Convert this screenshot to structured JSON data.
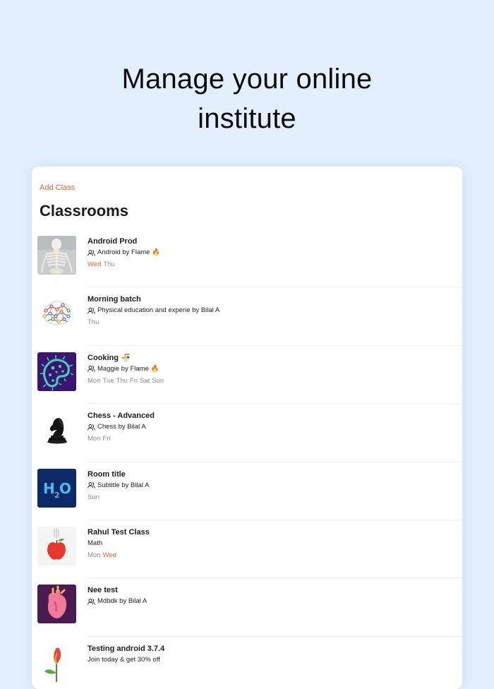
{
  "headline": {
    "line1": "Manage your online",
    "line2": "institute"
  },
  "card": {
    "add_class_label": "Add Class",
    "title": "Classrooms"
  },
  "accent_color": "#e0632b",
  "classes": [
    {
      "title": "Android Prod",
      "subtitle": "Android by Flame 🔥",
      "show_people_icon": true,
      "thumbnail": "skeleton",
      "days": [
        {
          "label": "Wed",
          "active": true
        },
        {
          "label": "Thu",
          "active": false
        }
      ]
    },
    {
      "title": "Morning batch",
      "subtitle": "Physical education and experie by Bilal A",
      "show_people_icon": true,
      "thumbnail": "brain-network",
      "days": [
        {
          "label": "Thu",
          "active": false
        }
      ]
    },
    {
      "title": "Cooking 🍜",
      "subtitle": "Maggie by Flame 🔥",
      "show_people_icon": true,
      "thumbnail": "microbe",
      "days": [
        {
          "label": "Mon",
          "active": false
        },
        {
          "label": "Tue",
          "active": false
        },
        {
          "label": "Thu",
          "active": false
        },
        {
          "label": "Fri",
          "active": false
        },
        {
          "label": "Sat",
          "active": false
        },
        {
          "label": "Sun",
          "active": false
        }
      ]
    },
    {
      "title": "Chess - Advanced",
      "subtitle": "Chess by Bilal A",
      "show_people_icon": true,
      "thumbnail": "chess-knight",
      "days": [
        {
          "label": "Mon",
          "active": false
        },
        {
          "label": "Fri",
          "active": false
        }
      ]
    },
    {
      "title": "Room title",
      "subtitle": "Subtitle by Bilal A",
      "show_people_icon": true,
      "thumbnail": "h2o",
      "days": [
        {
          "label": "Sun",
          "active": false
        }
      ]
    },
    {
      "title": "Rahul Test Class",
      "subtitle": "Math",
      "show_people_icon": false,
      "thumbnail": "apple",
      "days": [
        {
          "label": "Mon",
          "active": false
        },
        {
          "label": "Wed",
          "active": true
        }
      ]
    },
    {
      "title": "Nee test",
      "subtitle": "Mdbdk by Bilal A",
      "show_people_icon": true,
      "thumbnail": "heart",
      "days": []
    },
    {
      "title": "Testing android 3.7.4",
      "subtitle": "Join today & get 30% off",
      "show_people_icon": false,
      "thumbnail": "flower",
      "days": []
    }
  ]
}
